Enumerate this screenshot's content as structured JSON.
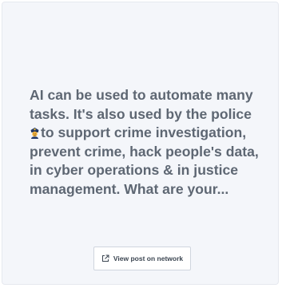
{
  "post": {
    "text_before_emoji": "AI can be used to automate many tasks. It's also used by the police ",
    "emoji_icon": "police-officer-emoji-icon",
    "text_after_emoji": "to support crime investigation, prevent crime, hack people's data, in cyber operations & in justice management. What are your..."
  },
  "button": {
    "label": "View post on network",
    "icon": "external-link-icon"
  },
  "colors": {
    "card_background": "#f4f6fa",
    "text": "#5e6773",
    "button_border": "#cfd5de",
    "button_text": "#3c4652"
  }
}
